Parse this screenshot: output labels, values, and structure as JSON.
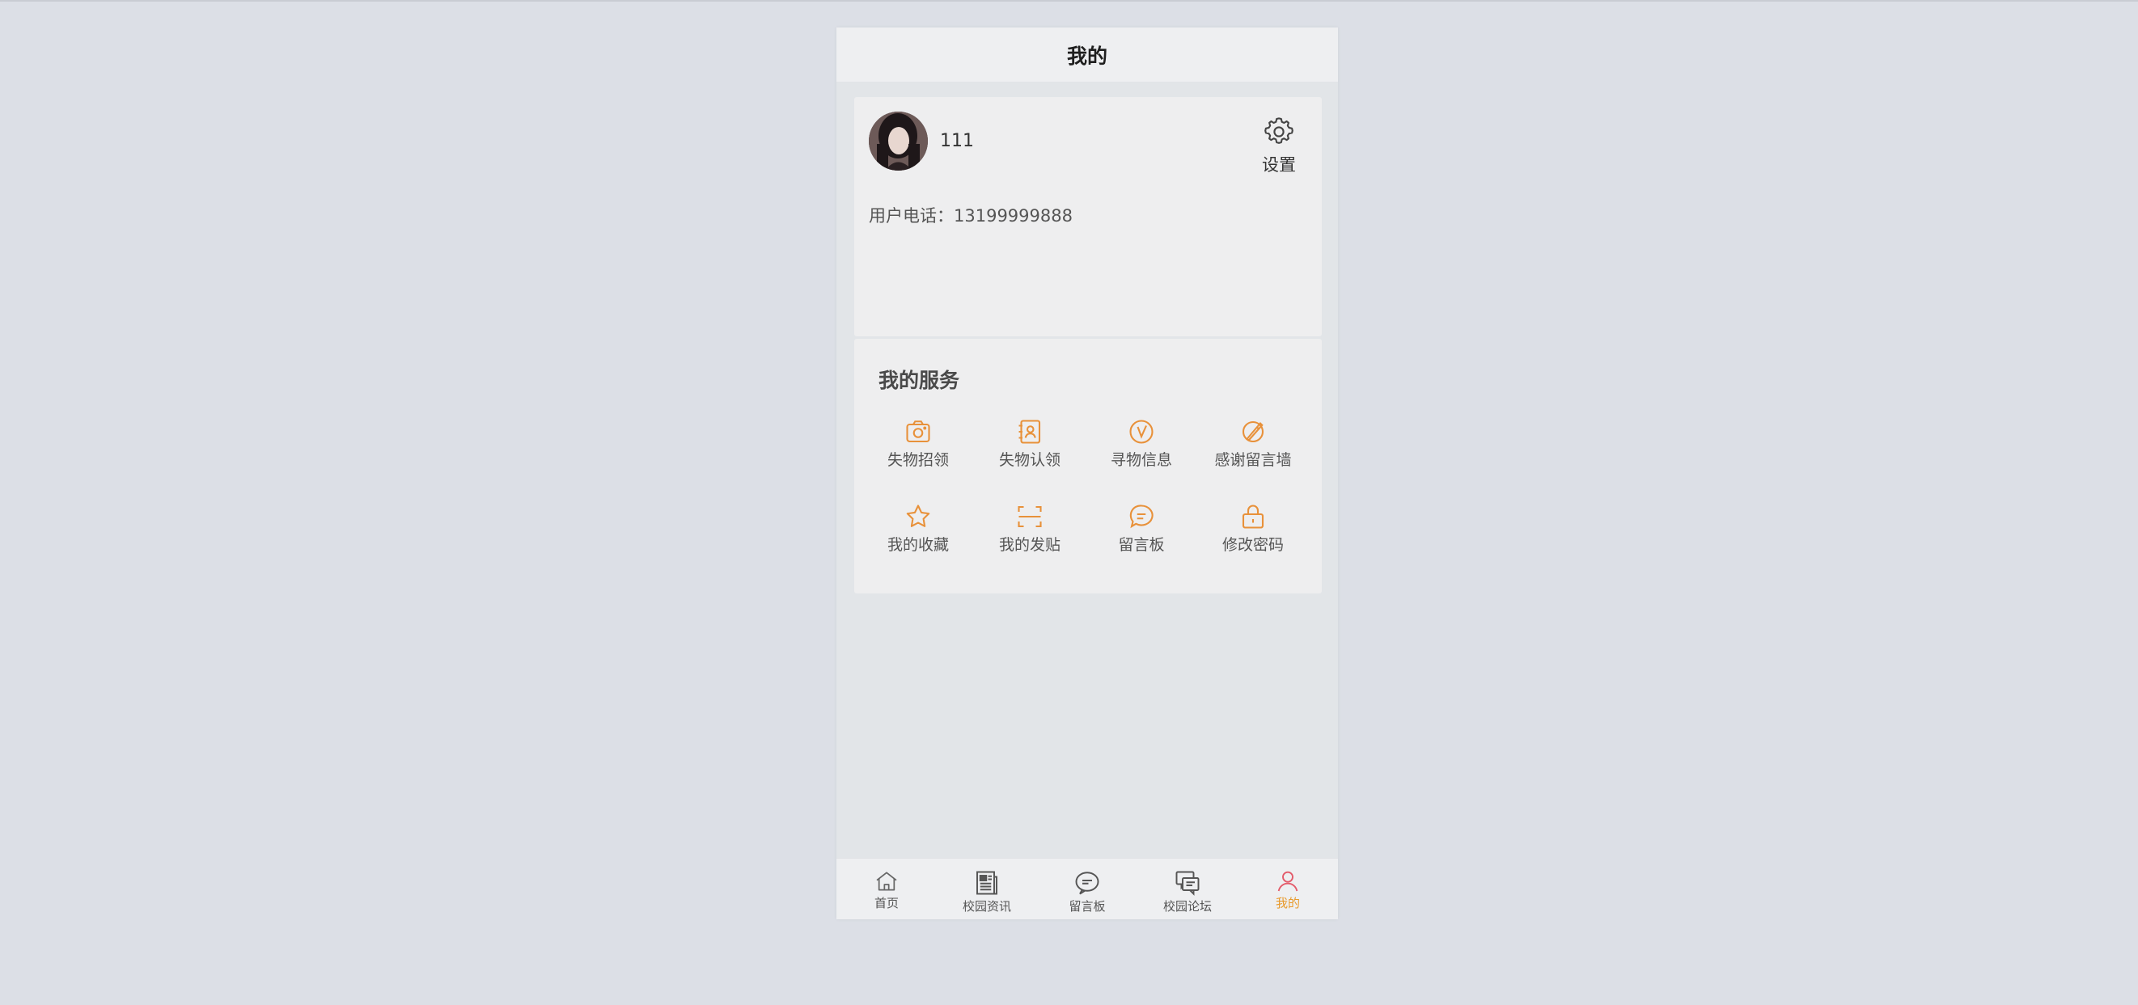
{
  "header": {
    "title": "我的"
  },
  "profile": {
    "username": "111",
    "settings_label": "设置",
    "phone_label": "用户电话：",
    "phone_value": "13199999888"
  },
  "services": {
    "title": "我的服务",
    "accent_color": "#e8913a",
    "items": [
      {
        "label": "失物招领",
        "icon": "camera-icon"
      },
      {
        "label": "失物认领",
        "icon": "contact-card-icon"
      },
      {
        "label": "寻物信息",
        "icon": "compass-icon"
      },
      {
        "label": "感谢留言墙",
        "icon": "pen-circle-icon"
      },
      {
        "label": "我的收藏",
        "icon": "star-icon"
      },
      {
        "label": "我的发贴",
        "icon": "scan-icon"
      },
      {
        "label": "留言板",
        "icon": "chat-bubble-icon"
      },
      {
        "label": "修改密码",
        "icon": "lock-icon"
      }
    ]
  },
  "tabbar": {
    "active_color": "#e89a2c",
    "items": [
      {
        "label": "首页",
        "icon": "home-icon"
      },
      {
        "label": "校园资讯",
        "icon": "newspaper-icon"
      },
      {
        "label": "留言板",
        "icon": "speech-bubble-icon"
      },
      {
        "label": "校园论坛",
        "icon": "forum-icon"
      },
      {
        "label": "我的",
        "icon": "user-icon",
        "active": true
      }
    ]
  }
}
